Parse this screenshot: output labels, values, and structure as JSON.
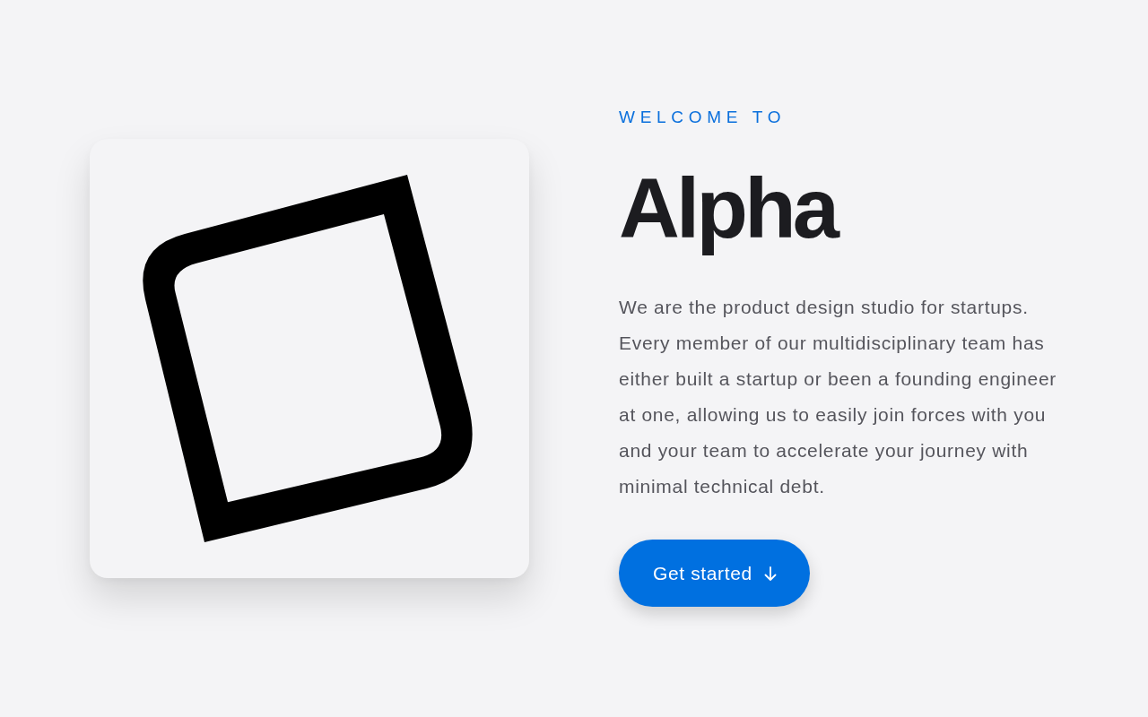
{
  "hero": {
    "eyebrow": "WELCOME TO",
    "title": "Alpha",
    "description": "We are the product design studio for startups. Every member of our multidisciplinary team has either built a startup or been a founding engineer at one, allowing us to easily join forces with you and your team to accelerate your journey with minimal technical debt.",
    "button": {
      "label": "Get started"
    }
  }
}
